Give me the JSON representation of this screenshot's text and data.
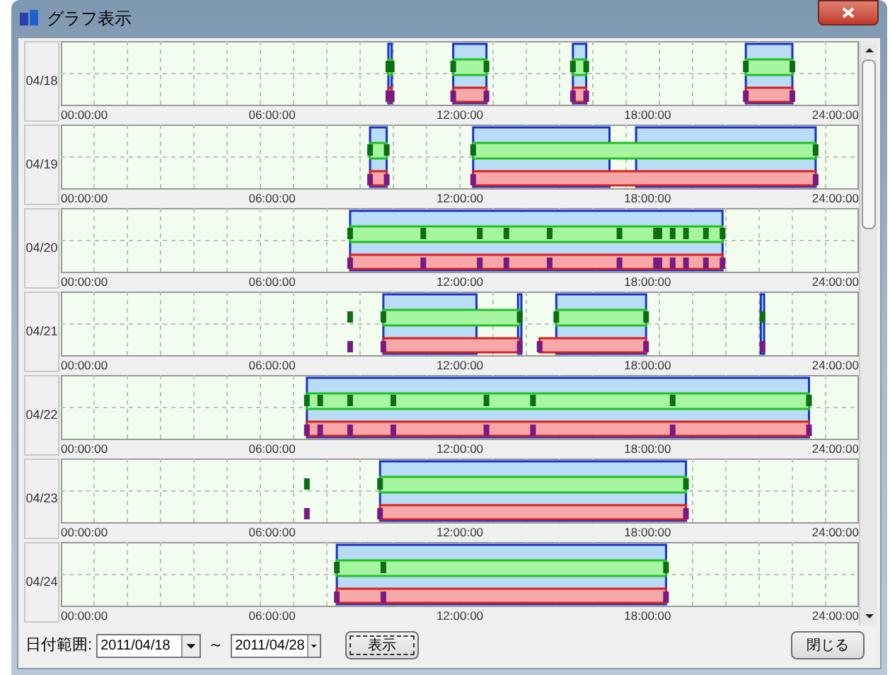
{
  "window": {
    "title": "グラフ表示"
  },
  "rows": [
    {
      "date": "04/18",
      "axis_labels": [
        "00:00:00",
        "06:00:00",
        "12:00:00",
        "18:00:00",
        "24:00:00"
      ]
    },
    {
      "date": "04/19",
      "axis_labels": [
        "00:00:00",
        "06:00:00",
        "12:00:00",
        "18:00:00",
        "24:00:00"
      ]
    },
    {
      "date": "04/20",
      "axis_labels": [
        "00:00:00",
        "06:00:00",
        "12:00:00",
        "18:00:00",
        "24:00:00"
      ]
    },
    {
      "date": "04/21",
      "axis_labels": [
        "00:00:00",
        "06:00:00",
        "12:00:00",
        "18:00:00",
        "24:00:00"
      ]
    },
    {
      "date": "04/22",
      "axis_labels": [
        "00:00:00",
        "06:00:00",
        "12:00:00",
        "18:00:00",
        "24:00:00"
      ]
    },
    {
      "date": "04/23",
      "axis_labels": [
        "00:00:00",
        "06:00:00",
        "12:00:00",
        "18:00:00",
        "24:00:00"
      ]
    },
    {
      "date": "04/24",
      "axis_labels": [
        "00:00:00",
        "06:00:00",
        "12:00:00",
        "18:00:00",
        "24:00:00"
      ]
    }
  ],
  "footer": {
    "range_label": "日付範囲:",
    "from": "2011/04/18",
    "separator": "～",
    "to": "2011/04/28",
    "show_button": "表示",
    "close_button": "閉じる"
  }
}
